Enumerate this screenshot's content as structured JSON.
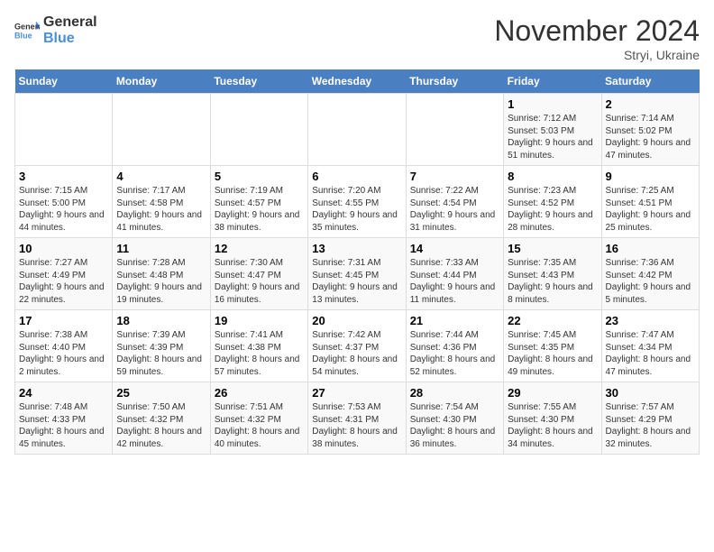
{
  "header": {
    "logo_general": "General",
    "logo_blue": "Blue",
    "title": "November 2024",
    "location": "Stryi, Ukraine"
  },
  "days_of_week": [
    "Sunday",
    "Monday",
    "Tuesday",
    "Wednesday",
    "Thursday",
    "Friday",
    "Saturday"
  ],
  "weeks": [
    [
      {
        "day": "",
        "info": ""
      },
      {
        "day": "",
        "info": ""
      },
      {
        "day": "",
        "info": ""
      },
      {
        "day": "",
        "info": ""
      },
      {
        "day": "",
        "info": ""
      },
      {
        "day": "1",
        "info": "Sunrise: 7:12 AM\nSunset: 5:03 PM\nDaylight: 9 hours and 51 minutes."
      },
      {
        "day": "2",
        "info": "Sunrise: 7:14 AM\nSunset: 5:02 PM\nDaylight: 9 hours and 47 minutes."
      }
    ],
    [
      {
        "day": "3",
        "info": "Sunrise: 7:15 AM\nSunset: 5:00 PM\nDaylight: 9 hours and 44 minutes."
      },
      {
        "day": "4",
        "info": "Sunrise: 7:17 AM\nSunset: 4:58 PM\nDaylight: 9 hours and 41 minutes."
      },
      {
        "day": "5",
        "info": "Sunrise: 7:19 AM\nSunset: 4:57 PM\nDaylight: 9 hours and 38 minutes."
      },
      {
        "day": "6",
        "info": "Sunrise: 7:20 AM\nSunset: 4:55 PM\nDaylight: 9 hours and 35 minutes."
      },
      {
        "day": "7",
        "info": "Sunrise: 7:22 AM\nSunset: 4:54 PM\nDaylight: 9 hours and 31 minutes."
      },
      {
        "day": "8",
        "info": "Sunrise: 7:23 AM\nSunset: 4:52 PM\nDaylight: 9 hours and 28 minutes."
      },
      {
        "day": "9",
        "info": "Sunrise: 7:25 AM\nSunset: 4:51 PM\nDaylight: 9 hours and 25 minutes."
      }
    ],
    [
      {
        "day": "10",
        "info": "Sunrise: 7:27 AM\nSunset: 4:49 PM\nDaylight: 9 hours and 22 minutes."
      },
      {
        "day": "11",
        "info": "Sunrise: 7:28 AM\nSunset: 4:48 PM\nDaylight: 9 hours and 19 minutes."
      },
      {
        "day": "12",
        "info": "Sunrise: 7:30 AM\nSunset: 4:47 PM\nDaylight: 9 hours and 16 minutes."
      },
      {
        "day": "13",
        "info": "Sunrise: 7:31 AM\nSunset: 4:45 PM\nDaylight: 9 hours and 13 minutes."
      },
      {
        "day": "14",
        "info": "Sunrise: 7:33 AM\nSunset: 4:44 PM\nDaylight: 9 hours and 11 minutes."
      },
      {
        "day": "15",
        "info": "Sunrise: 7:35 AM\nSunset: 4:43 PM\nDaylight: 9 hours and 8 minutes."
      },
      {
        "day": "16",
        "info": "Sunrise: 7:36 AM\nSunset: 4:42 PM\nDaylight: 9 hours and 5 minutes."
      }
    ],
    [
      {
        "day": "17",
        "info": "Sunrise: 7:38 AM\nSunset: 4:40 PM\nDaylight: 9 hours and 2 minutes."
      },
      {
        "day": "18",
        "info": "Sunrise: 7:39 AM\nSunset: 4:39 PM\nDaylight: 8 hours and 59 minutes."
      },
      {
        "day": "19",
        "info": "Sunrise: 7:41 AM\nSunset: 4:38 PM\nDaylight: 8 hours and 57 minutes."
      },
      {
        "day": "20",
        "info": "Sunrise: 7:42 AM\nSunset: 4:37 PM\nDaylight: 8 hours and 54 minutes."
      },
      {
        "day": "21",
        "info": "Sunrise: 7:44 AM\nSunset: 4:36 PM\nDaylight: 8 hours and 52 minutes."
      },
      {
        "day": "22",
        "info": "Sunrise: 7:45 AM\nSunset: 4:35 PM\nDaylight: 8 hours and 49 minutes."
      },
      {
        "day": "23",
        "info": "Sunrise: 7:47 AM\nSunset: 4:34 PM\nDaylight: 8 hours and 47 minutes."
      }
    ],
    [
      {
        "day": "24",
        "info": "Sunrise: 7:48 AM\nSunset: 4:33 PM\nDaylight: 8 hours and 45 minutes."
      },
      {
        "day": "25",
        "info": "Sunrise: 7:50 AM\nSunset: 4:32 PM\nDaylight: 8 hours and 42 minutes."
      },
      {
        "day": "26",
        "info": "Sunrise: 7:51 AM\nSunset: 4:32 PM\nDaylight: 8 hours and 40 minutes."
      },
      {
        "day": "27",
        "info": "Sunrise: 7:53 AM\nSunset: 4:31 PM\nDaylight: 8 hours and 38 minutes."
      },
      {
        "day": "28",
        "info": "Sunrise: 7:54 AM\nSunset: 4:30 PM\nDaylight: 8 hours and 36 minutes."
      },
      {
        "day": "29",
        "info": "Sunrise: 7:55 AM\nSunset: 4:30 PM\nDaylight: 8 hours and 34 minutes."
      },
      {
        "day": "30",
        "info": "Sunrise: 7:57 AM\nSunset: 4:29 PM\nDaylight: 8 hours and 32 minutes."
      }
    ]
  ]
}
